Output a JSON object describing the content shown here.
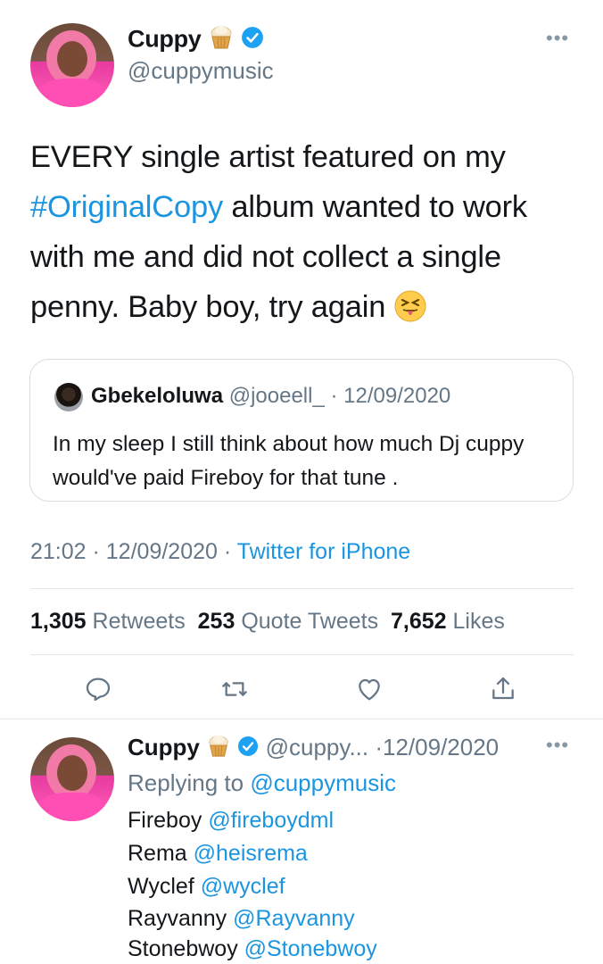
{
  "tweet": {
    "author_name": "Cuppy",
    "author_handle": "@cuppymusic",
    "more_icon": "more-icon",
    "text_before": "EVERY single artist featured on my ",
    "hashtag": "#OriginalCopy",
    "text_after": " album wanted to work with me and did not collect a single penny. Baby boy, try again",
    "emoji": "squinting-face-with-tongue"
  },
  "quote": {
    "author_name": "Gbekeloluwa",
    "author_handle": "@jooeell_",
    "separator": " · ",
    "date": "12/09/2020",
    "text": "In my sleep I still think about how much Dj cuppy would've paid Fireboy for that tune ."
  },
  "meta": {
    "time": "21:02",
    "sep1": " · ",
    "date": "12/09/2020",
    "sep2": " · ",
    "source": "Twitter for iPhone"
  },
  "stats": {
    "retweets_count": "1,305",
    "retweets_label": "Retweets",
    "quotes_count": "253",
    "quotes_label": "Quote Tweets",
    "likes_count": "7,652",
    "likes_label": "Likes"
  },
  "actions": [
    "reply-icon",
    "retweet-icon",
    "like-icon",
    "share-icon"
  ],
  "reply": {
    "author_name": "Cuppy",
    "author_handle": "@cuppy...",
    "separator": " ·",
    "date": "12/09/2020",
    "replying_prefix": "Replying to ",
    "replying_to": "@cuppymusic",
    "lines": [
      {
        "name": "Fireboy",
        "handle": "@fireboydml"
      },
      {
        "name": "Rema",
        "handle": "@heisrema"
      },
      {
        "name": "Wyclef",
        "handle": "@wyclef"
      },
      {
        "name": "Rayvanny",
        "handle": "@Rayvanny"
      },
      {
        "name": "Stonebwoy",
        "handle": "@Stonebwoy"
      }
    ]
  },
  "colors": {
    "link_blue": "#1b95e0",
    "secondary_gray": "#657786",
    "divider": "#e1e8ed"
  }
}
